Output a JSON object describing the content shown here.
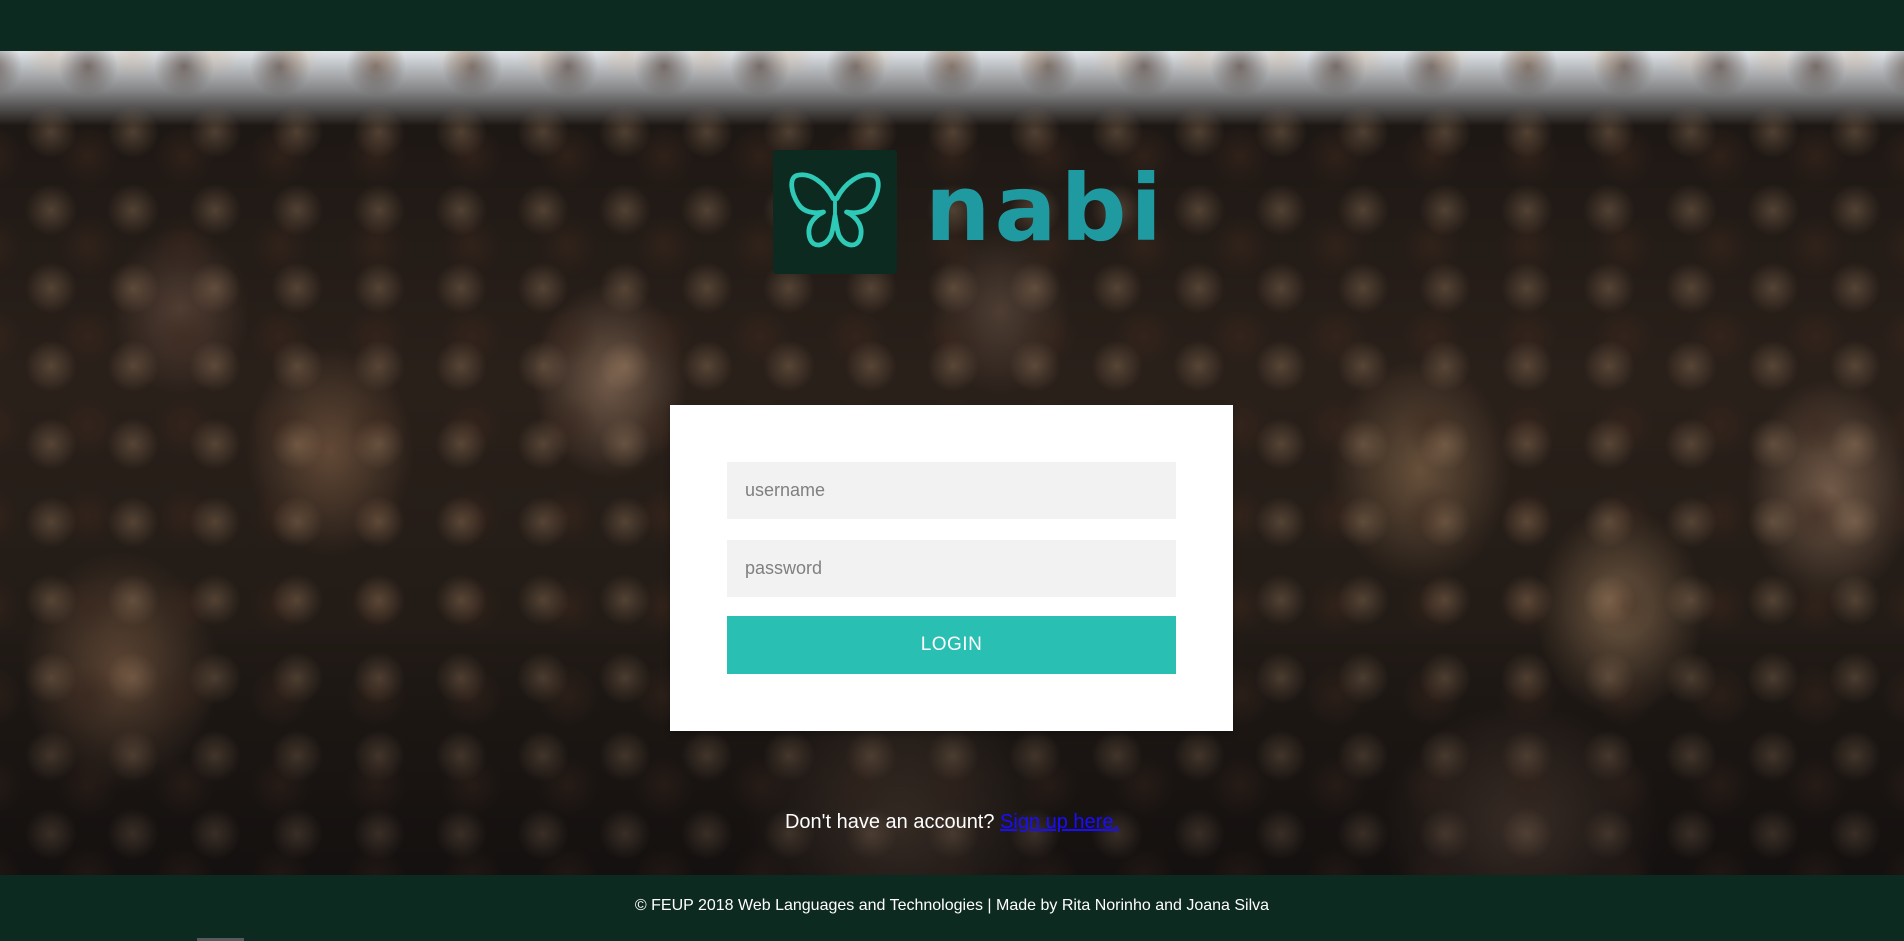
{
  "brand": {
    "name": "nabi",
    "logo_icon": "butterfly-icon",
    "colors": {
      "dark_green": "#0d2a20",
      "teal_text": "#1e9aa0",
      "teal_button": "#29bfb2",
      "link_blue": "#1a0dff"
    }
  },
  "login_form": {
    "username_placeholder": "username",
    "password_placeholder": "password",
    "login_label": "LOGIN"
  },
  "signup": {
    "prompt": "Don't have an account? ",
    "link_label": "Sign up here."
  },
  "footer": {
    "text": "© FEUP 2018 Web Languages and Technologies | Made by Rita Norinho and Joana Silva"
  }
}
